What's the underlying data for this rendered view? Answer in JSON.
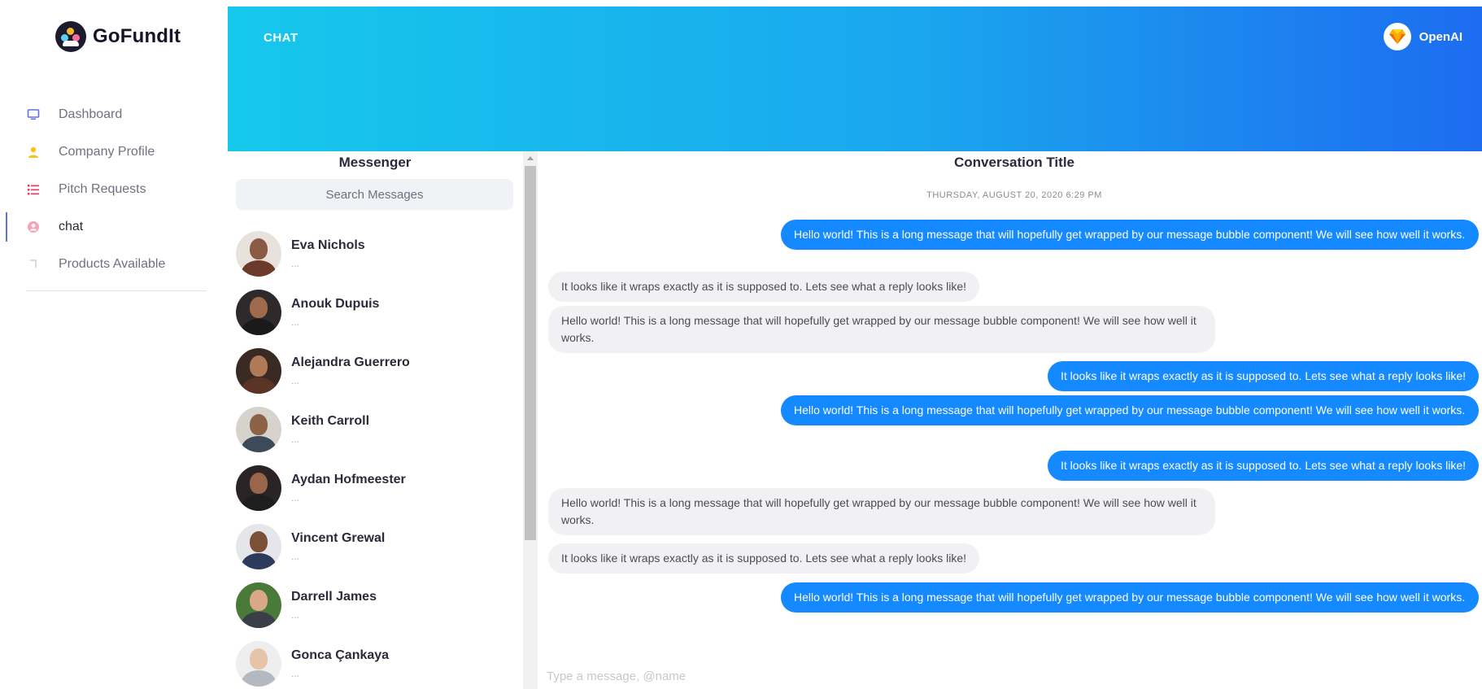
{
  "app": {
    "name": "GoFundIt"
  },
  "sidebar": {
    "items": [
      {
        "label": "Dashboard",
        "icon": "monitor-icon",
        "color": "#5e72e4",
        "active": false
      },
      {
        "label": "Company Profile",
        "icon": "user-icon",
        "color": "#f5c31a",
        "active": false
      },
      {
        "label": "Pitch Requests",
        "icon": "list-icon",
        "color": "#f5365c",
        "active": false
      },
      {
        "label": "chat",
        "icon": "user-circle-icon",
        "color": "#f3a4b5",
        "active": true
      },
      {
        "label": "Products Available",
        "icon": "box-icon",
        "color": "#c0c2cc",
        "active": false
      }
    ]
  },
  "header": {
    "title": "CHAT",
    "user": {
      "name": "OpenAI",
      "avatar_icon": "sketch-diamond-icon"
    }
  },
  "messenger": {
    "title": "Messenger",
    "search_placeholder": "Search Messages",
    "contacts": [
      {
        "name": "Eva Nichols",
        "preview": "..."
      },
      {
        "name": "Anouk Dupuis",
        "preview": "..."
      },
      {
        "name": "Alejandra Guerrero",
        "preview": "..."
      },
      {
        "name": "Keith Carroll",
        "preview": "..."
      },
      {
        "name": "Aydan Hofmeester",
        "preview": "..."
      },
      {
        "name": "Vincent Grewal",
        "preview": "..."
      },
      {
        "name": "Darrell James",
        "preview": "..."
      },
      {
        "name": "Gonca Çankaya",
        "preview": "..."
      }
    ]
  },
  "conversation": {
    "title": "Conversation Title",
    "timestamp": "THURSDAY, AUGUST 20, 2020 6:29 PM",
    "messages": [
      {
        "direction": "out",
        "text": "Hello world! This is a long message that will hopefully get wrapped by our message bubble component! We will see how well it works."
      },
      {
        "direction": "in",
        "text": "It looks like it wraps exactly as it is supposed to. Lets see what a reply looks like!"
      },
      {
        "direction": "in",
        "text": "Hello world! This is a long message that will hopefully get wrapped by our message bubble component! We will see how well it works."
      },
      {
        "direction": "out",
        "text": "It looks like it wraps exactly as it is supposed to. Lets see what a reply looks like!"
      },
      {
        "direction": "out",
        "text": "Hello world! This is a long message that will hopefully get wrapped by our message bubble component! We will see how well it works."
      },
      {
        "direction": "out",
        "text": "It looks like it wraps exactly as it is supposed to. Lets see what a reply looks like!"
      },
      {
        "direction": "in",
        "text": "Hello world! This is a long message that will hopefully get wrapped by our message bubble component! We will see how well it works."
      },
      {
        "direction": "in",
        "text": "It looks like it wraps exactly as it is supposed to. Lets see what a reply looks like!"
      },
      {
        "direction": "out",
        "text": "Hello world! This is a long message that will hopefully get wrapped by our message bubble component! We will see how well it works."
      }
    ],
    "composer_placeholder": "Type a message, @name"
  },
  "colors": {
    "accent": "#5e72e4",
    "bubble_out": "#1589ff",
    "bubble_in": "#f1f1f4",
    "header_start": "#16c8ec",
    "header_end": "#1d6cf0"
  }
}
